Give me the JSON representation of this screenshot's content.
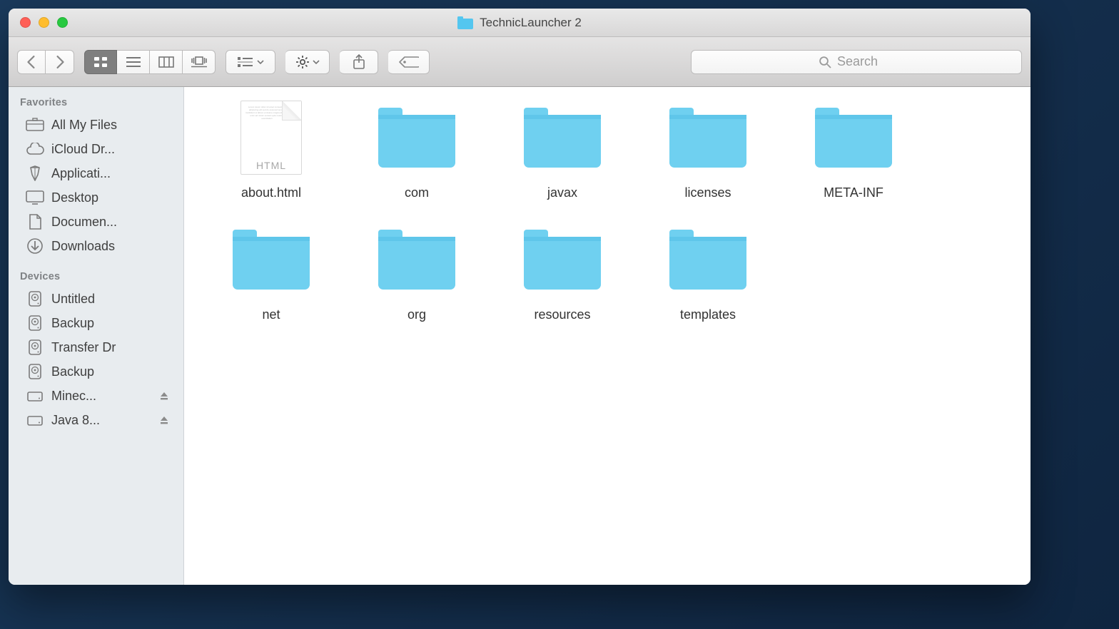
{
  "window": {
    "title": "TechnicLauncher 2"
  },
  "toolbar": {
    "search_placeholder": "Search"
  },
  "sidebar": {
    "sections": [
      {
        "header": "Favorites",
        "items": [
          {
            "label": "All My Files",
            "icon": "all-my-files"
          },
          {
            "label": "iCloud Dr...",
            "icon": "cloud"
          },
          {
            "label": "Applicati...",
            "icon": "applications"
          },
          {
            "label": "Desktop",
            "icon": "desktop"
          },
          {
            "label": "Documen...",
            "icon": "documents"
          },
          {
            "label": "Downloads",
            "icon": "downloads"
          }
        ]
      },
      {
        "header": "Devices",
        "items": [
          {
            "label": "Untitled",
            "icon": "disk"
          },
          {
            "label": "Backup",
            "icon": "disk"
          },
          {
            "label": "Transfer Dr",
            "icon": "disk"
          },
          {
            "label": "Backup",
            "icon": "disk"
          },
          {
            "label": "Minec...",
            "icon": "ext",
            "eject": true
          },
          {
            "label": "Java 8...",
            "icon": "ext",
            "eject": true
          }
        ]
      }
    ]
  },
  "content": {
    "items": [
      {
        "name": "about.html",
        "type": "html",
        "badge": "HTML"
      },
      {
        "name": "com",
        "type": "folder"
      },
      {
        "name": "javax",
        "type": "folder"
      },
      {
        "name": "licenses",
        "type": "folder"
      },
      {
        "name": "META-INF",
        "type": "folder"
      },
      {
        "name": "net",
        "type": "folder"
      },
      {
        "name": "org",
        "type": "folder"
      },
      {
        "name": "resources",
        "type": "folder"
      },
      {
        "name": "templates",
        "type": "folder"
      }
    ]
  }
}
